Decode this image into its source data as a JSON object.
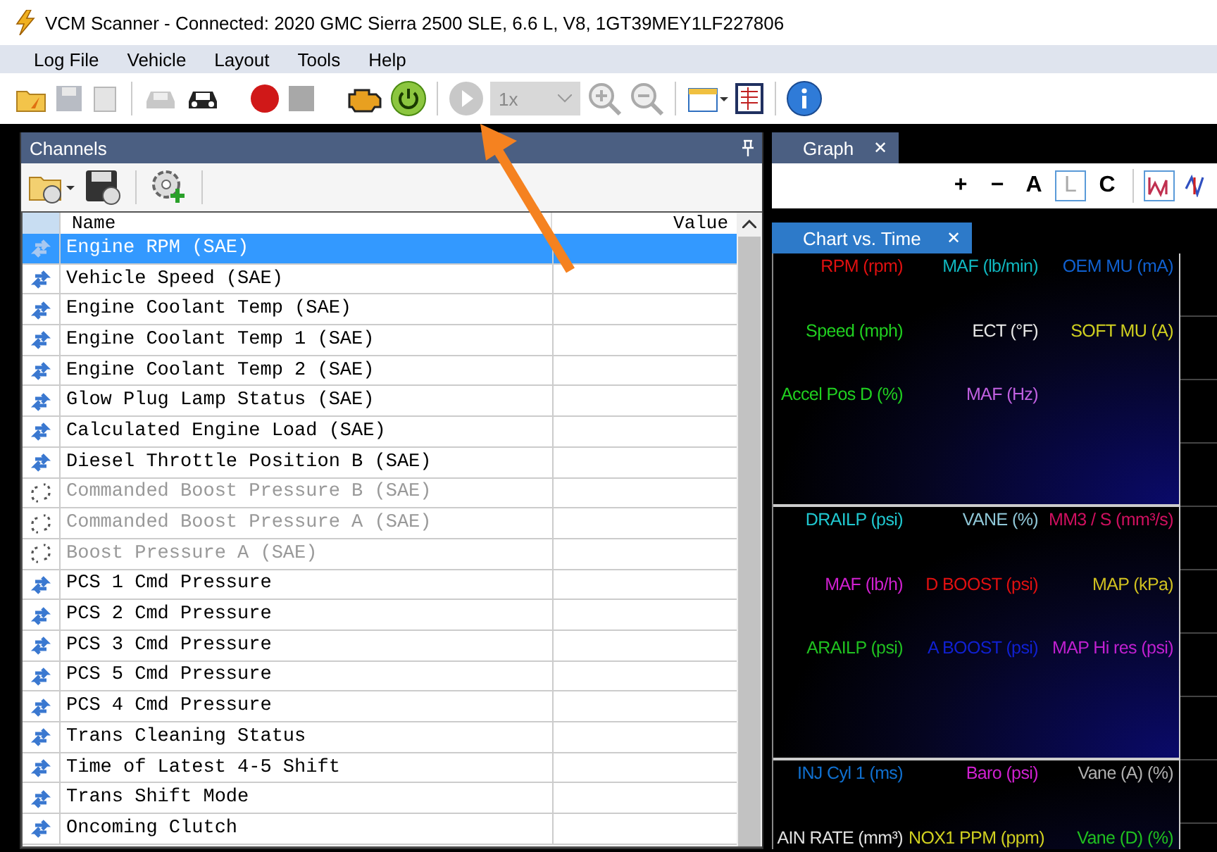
{
  "window": {
    "title": "VCM Scanner - Connected: 2020 GMC Sierra 2500 SLE, 6.6 L, V8, 1GT39MEY1LF227806"
  },
  "menu": [
    "Log File",
    "Vehicle",
    "Layout",
    "Tools",
    "Help"
  ],
  "toolbar": {
    "speed_select": {
      "value": "1x"
    }
  },
  "channels_panel": {
    "title": "Channels",
    "table": {
      "columns": [
        "Name",
        "Value"
      ],
      "rows": [
        {
          "name": "Engine RPM (SAE)",
          "selected": true,
          "disabled": false
        },
        {
          "name": "Vehicle Speed (SAE)",
          "selected": false,
          "disabled": false
        },
        {
          "name": "Engine Coolant Temp (SAE)",
          "selected": false,
          "disabled": false
        },
        {
          "name": "Engine Coolant Temp 1 (SAE)",
          "selected": false,
          "disabled": false
        },
        {
          "name": "Engine Coolant Temp 2 (SAE)",
          "selected": false,
          "disabled": false
        },
        {
          "name": "Glow Plug Lamp Status (SAE)",
          "selected": false,
          "disabled": false
        },
        {
          "name": "Calculated Engine Load (SAE)",
          "selected": false,
          "disabled": false
        },
        {
          "name": "Diesel Throttle Position B (SAE)",
          "selected": false,
          "disabled": false
        },
        {
          "name": "Commanded Boost Pressure B (SAE)",
          "selected": false,
          "disabled": true
        },
        {
          "name": "Commanded Boost Pressure A (SAE)",
          "selected": false,
          "disabled": true
        },
        {
          "name": "Boost Pressure A (SAE)",
          "selected": false,
          "disabled": true
        },
        {
          "name": "PCS 1 Cmd Pressure",
          "selected": false,
          "disabled": false
        },
        {
          "name": "PCS 2 Cmd Pressure",
          "selected": false,
          "disabled": false
        },
        {
          "name": "PCS 3 Cmd Pressure",
          "selected": false,
          "disabled": false
        },
        {
          "name": "PCS 5 Cmd Pressure",
          "selected": false,
          "disabled": false
        },
        {
          "name": "PCS 4 Cmd Pressure",
          "selected": false,
          "disabled": false
        },
        {
          "name": "Trans Cleaning Status",
          "selected": false,
          "disabled": false
        },
        {
          "name": "Time of Latest 4-5 Shift",
          "selected": false,
          "disabled": false
        },
        {
          "name": "Trans Shift Mode",
          "selected": false,
          "disabled": false
        },
        {
          "name": "Oncoming Clutch",
          "selected": false,
          "disabled": false
        }
      ]
    }
  },
  "graph_panel": {
    "tab": {
      "label": "Graph",
      "close": "✕"
    },
    "tools": [
      {
        "label": "+",
        "selected": false
      },
      {
        "label": "−",
        "selected": false
      },
      {
        "label": "A",
        "selected": false
      },
      {
        "label": "L",
        "selected": true
      },
      {
        "label": "C",
        "selected": false
      }
    ],
    "chart_tab": {
      "label": "Chart vs. Time",
      "close": "✕"
    },
    "chart_panels": [
      {
        "labels": [
          {
            "text": "RPM (rpm)",
            "color": "#e01010"
          },
          {
            "text": "MAF (lb/min)",
            "color": "#10b8c0"
          },
          {
            "text": "OEM MU (mA)",
            "color": "#1060d0"
          },
          {
            "text": "Speed (mph)",
            "color": "#20d020"
          },
          {
            "text": "ECT (°F)",
            "color": "#e8e8e8"
          },
          {
            "text": "SOFT MU (A)",
            "color": "#d0d020"
          },
          {
            "text": "Accel Pos D (%)",
            "color": "#20d020"
          },
          {
            "text": "MAF (Hz)",
            "color": "#c060e0"
          }
        ]
      },
      {
        "labels": [
          {
            "text": "DRAILP (psi)",
            "color": "#20c8d0"
          },
          {
            "text": "VANE (%)",
            "color": "#90c8d8"
          },
          {
            "text": "MM3 / S (mm³/s)",
            "color": "#d01060"
          },
          {
            "text": "MAF (lb/h)",
            "color": "#d020d0"
          },
          {
            "text": "D BOOST (psi)",
            "color": "#e01010"
          },
          {
            "text": "MAP (kPa)",
            "color": "#d0c020"
          },
          {
            "text": "ARAILP (psi)",
            "color": "#20c020"
          },
          {
            "text": "A BOOST (psi)",
            "color": "#1020d0"
          },
          {
            "text": "MAP Hi res (psi)",
            "color": "#c020d0"
          }
        ]
      },
      {
        "labels": [
          {
            "text": "INJ Cyl 1 (ms)",
            "color": "#1070d0"
          },
          {
            "text": "Baro (psi)",
            "color": "#d020d0"
          },
          {
            "text": "Vane (A) (%)",
            "color": "#b0b0b0"
          },
          {
            "text": "AIN RATE (mm³)",
            "color": "#e0e0e0"
          },
          {
            "text": "NOX1 PPM (ppm)",
            "color": "#d0d020"
          },
          {
            "text": "Vane (D) (%)",
            "color": "#20c020"
          }
        ]
      }
    ]
  }
}
